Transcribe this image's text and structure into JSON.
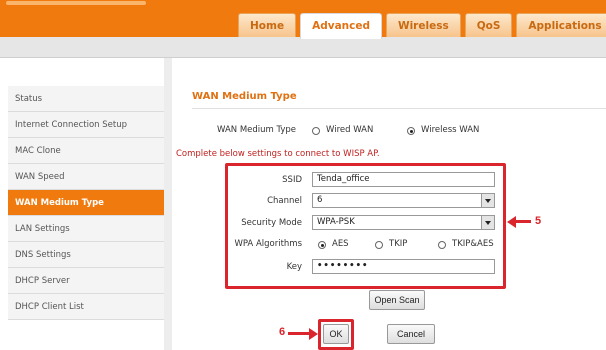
{
  "nav": {
    "tabs": [
      {
        "label": "Home"
      },
      {
        "label": "Advanced"
      },
      {
        "label": "Wireless"
      },
      {
        "label": "QoS"
      },
      {
        "label": "Applications"
      }
    ]
  },
  "sidebar": {
    "items": [
      {
        "label": "Status"
      },
      {
        "label": "Internet Connection Setup"
      },
      {
        "label": "MAC Clone"
      },
      {
        "label": "WAN Speed"
      },
      {
        "label": "WAN Medium Type"
      },
      {
        "label": "LAN Settings"
      },
      {
        "label": "DNS Settings"
      },
      {
        "label": "DHCP Server"
      },
      {
        "label": "DHCP Client List"
      }
    ]
  },
  "main": {
    "title": "WAN Medium Type",
    "wan_medium_label": "WAN Medium Type",
    "option_wired": "Wired WAN",
    "option_wireless": "Wireless WAN",
    "note": "Complete below settings to connect to WISP AP.",
    "ssid_label": "SSID",
    "ssid_value": "Tenda_office",
    "channel_label": "Channel",
    "channel_value": "6",
    "security_label": "Security Mode",
    "security_value": "WPA-PSK",
    "algo_label": "WPA Algorithms",
    "algo_aes": "AES",
    "algo_tkip": "TKIP",
    "algo_tkipaes": "TKIP&AES",
    "key_label": "Key",
    "key_value": "••••••••",
    "open_scan": "Open Scan",
    "ok": "OK",
    "cancel": "Cancel"
  },
  "annotations": {
    "callout_5": "5",
    "callout_6": "6"
  },
  "colors": {
    "brand_orange": "#f07a0e",
    "highlight_red": "#d9252b"
  }
}
